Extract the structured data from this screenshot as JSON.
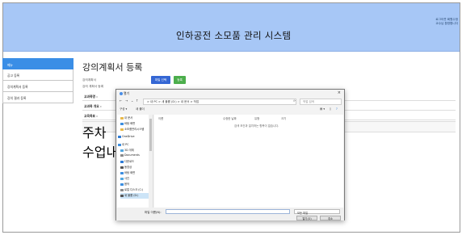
{
  "header": {
    "title": "인하공전 소모품 관리 시스템",
    "user_line1": "로그아웃 회원수정",
    "user_line2": "교수님 환영합니다"
  },
  "sidebar": {
    "items": [
      {
        "label": "메뉴",
        "active": true
      },
      {
        "label": "공고 등록",
        "active": false
      },
      {
        "label": "강의계획서 등록",
        "active": false
      },
      {
        "label": "강의 결과 등록",
        "active": false
      }
    ]
  },
  "main": {
    "title": "강의계획서 등록",
    "file_label": "강의계획서",
    "plan_label": "강의 계획서 등록",
    "select_file_button": "파일 선택",
    "register_button": "등록",
    "rows": [
      "교과목명 :",
      "교과목 개요 :",
      "교육목표 :"
    ],
    "table_headers": {
      "week": "주차",
      "content": "수업내용"
    }
  },
  "dialog": {
    "title": "열기",
    "address": "> 내 PC > 새 볼륨 (D:) > 내 문서 > 작업",
    "search_placeholder": "작업 검색",
    "toolbar_organize": "구성 ▾",
    "toolbar_new_folder": "새 폴더",
    "columns": [
      "이름",
      "수정한 날짜",
      "유형",
      "크기"
    ],
    "empty_message": "검색 조건과 일치하는 항목이 없습니다.",
    "tree": [
      {
        "label": "내 문서",
        "icon": "folder-icon",
        "color": "#e8b94a"
      },
      {
        "label": "바탕 화면",
        "icon": "folder-icon",
        "color": "#3c8ee0"
      },
      {
        "label": "소모품관리시스템",
        "icon": "folder-icon",
        "color": "#e8b94a"
      },
      {
        "label": "OneDrive",
        "icon": "cloud-icon",
        "color": "#2d7bd6"
      },
      {
        "label": "내 PC",
        "icon": "computer-icon",
        "color": "#3c8ee0"
      },
      {
        "label": "3D 개체",
        "icon": "cube-icon",
        "color": "#52a7e0"
      },
      {
        "label": "Documents",
        "icon": "document-icon",
        "color": "#8a8a8a"
      },
      {
        "label": "다운로드",
        "icon": "download-icon",
        "color": "#2d7bd6"
      },
      {
        "label": "동영상",
        "icon": "video-icon",
        "color": "#555555"
      },
      {
        "label": "바탕 화면",
        "icon": "folder-icon",
        "color": "#3c8ee0"
      },
      {
        "label": "사진",
        "icon": "picture-icon",
        "color": "#52a7e0"
      },
      {
        "label": "음악",
        "icon": "music-icon",
        "color": "#3c8ee0"
      },
      {
        "label": "로컬 디스크 (C:)",
        "icon": "drive-icon",
        "color": "#8a8a8a"
      },
      {
        "label": "새 볼륨 (D:)",
        "icon": "drive-icon",
        "color": "#555555",
        "selected": true
      }
    ],
    "filename_label": "파일 이름(N):",
    "filetype": "모든 파일",
    "open_button": "열기(O)",
    "cancel_button": "취소"
  }
}
